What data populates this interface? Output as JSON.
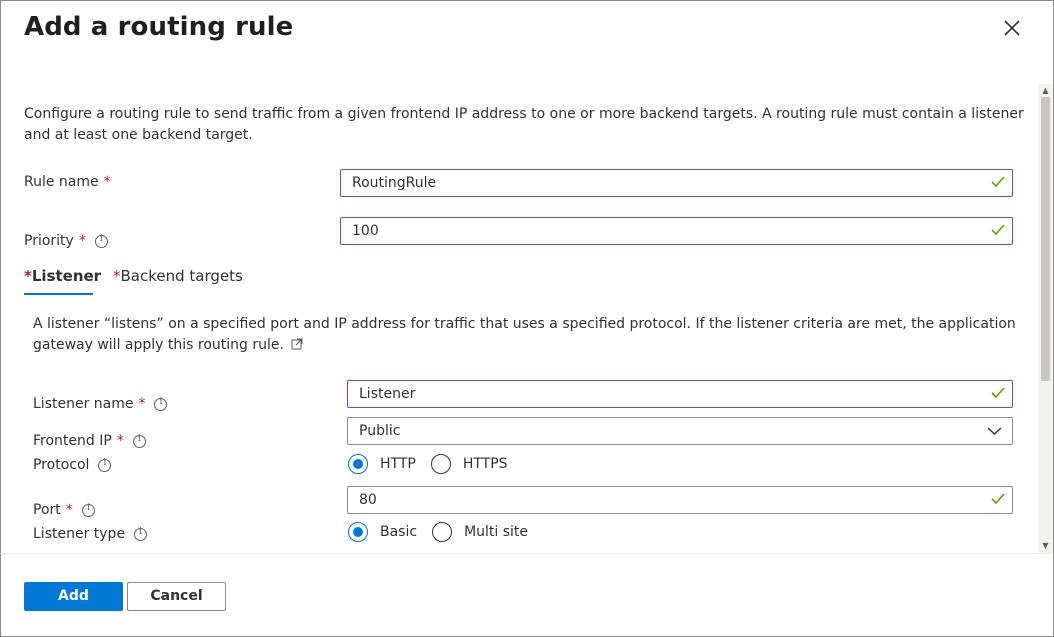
{
  "dialog": {
    "title": "Add a routing rule",
    "close_icon": "close-icon"
  },
  "description": "Configure a routing rule to send traffic from a given frontend IP address to one or more backend targets. A routing rule must contain a listener and at least one backend target.",
  "rule_name": {
    "label": "Rule name",
    "required": "*",
    "value": "RoutingRule"
  },
  "priority": {
    "label": "Priority",
    "required": "*",
    "value": "100"
  },
  "tabs": [
    {
      "star": "*",
      "label": "Listener",
      "selected": true
    },
    {
      "star": "*",
      "label": "Backend targets",
      "selected": false
    }
  ],
  "listener": {
    "description": "A listener “listens” on a specified port and IP address for traffic that uses a specified protocol. If the listener criteria are met, the application gateway will apply this routing rule.",
    "name": {
      "label": "Listener name",
      "required": "*",
      "value": "Listener"
    },
    "frontend_ip": {
      "label": "Frontend IP",
      "required": "*",
      "value": "Public"
    },
    "protocol": {
      "label": "Protocol",
      "options": [
        "HTTP",
        "HTTPS"
      ],
      "selected": "HTTP"
    },
    "port": {
      "label": "Port",
      "required": "*",
      "value": "80"
    },
    "listener_type": {
      "label": "Listener type",
      "options": [
        "Basic",
        "Multi site"
      ],
      "selected": "Basic"
    }
  },
  "footer": {
    "add_label": "Add",
    "cancel_label": "Cancel"
  },
  "colors": {
    "accent": "#0078d4",
    "valid_border": "#8a3bba",
    "check": "#57a300",
    "required": "#a4262c"
  }
}
